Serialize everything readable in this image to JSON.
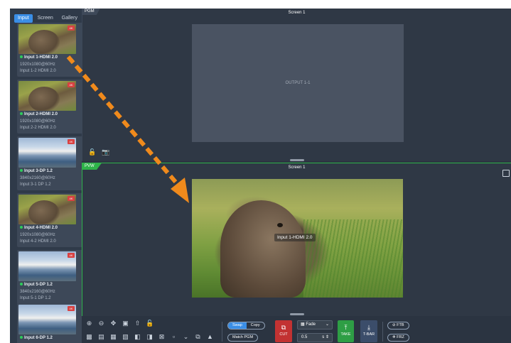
{
  "tabs": [
    {
      "label": "Input",
      "active": true
    },
    {
      "label": "Screen",
      "active": false
    },
    {
      "label": "Gallery",
      "active": false
    }
  ],
  "inputs": [
    {
      "name": "Input 1-HDMI 2.0",
      "resolution": "1920x1080@60Hz",
      "port": "Input 1-2  HDMI 2.0",
      "thumb": "marmot",
      "badge": "4K"
    },
    {
      "name": "Input 2-HDMI 2.0",
      "resolution": "1920x1080@60Hz",
      "port": "Input 2-2  HDMI 2.0",
      "thumb": "marmot",
      "badge": "4K"
    },
    {
      "name": "Input 3-DP 1.2",
      "resolution": "3840x2160@60Hz",
      "port": "Input 3-1  DP 1.2",
      "thumb": "coast",
      "badge": "4K"
    },
    {
      "name": "Input 4-HDMI 2.0",
      "resolution": "1920x1080@60Hz",
      "port": "Input 4-2  HDMI 2.0",
      "thumb": "marmot",
      "badge": "4K"
    },
    {
      "name": "Input 5-DP 1.2",
      "resolution": "3840x2160@60Hz",
      "port": "Input 5-1  DP 1.2",
      "thumb": "coast",
      "badge": "4K"
    },
    {
      "name": "Input 6-DP 1.2",
      "resolution": "",
      "port": "",
      "thumb": "coast",
      "badge": "4K"
    }
  ],
  "pgm": {
    "tag": "PGM",
    "screen_title": "Screen 1",
    "output_label": "OUTPUT 1-1"
  },
  "pvw": {
    "tag": "PVW",
    "screen_title": "Screen 1",
    "source_label": "Input 1-HDMI 2.0"
  },
  "toolbar": {
    "swap_label": "Swap",
    "copy_label": "Copy",
    "match_pgm_label": "Match PGM",
    "cut_label": "CUT",
    "transition_value": "Fade",
    "duration_value": "0.5",
    "duration_unit": "s",
    "take_label": "TAKE",
    "tbar_label": "T-BAR",
    "ftb_label": "FTB",
    "frz_label": "FRZ"
  },
  "colors": {
    "accent": "#3a8ee6",
    "pvw_green": "#2fb34a",
    "cut_red": "#c23232",
    "take_green": "#2e9e45",
    "arrow_orange": "#f08a1c"
  }
}
